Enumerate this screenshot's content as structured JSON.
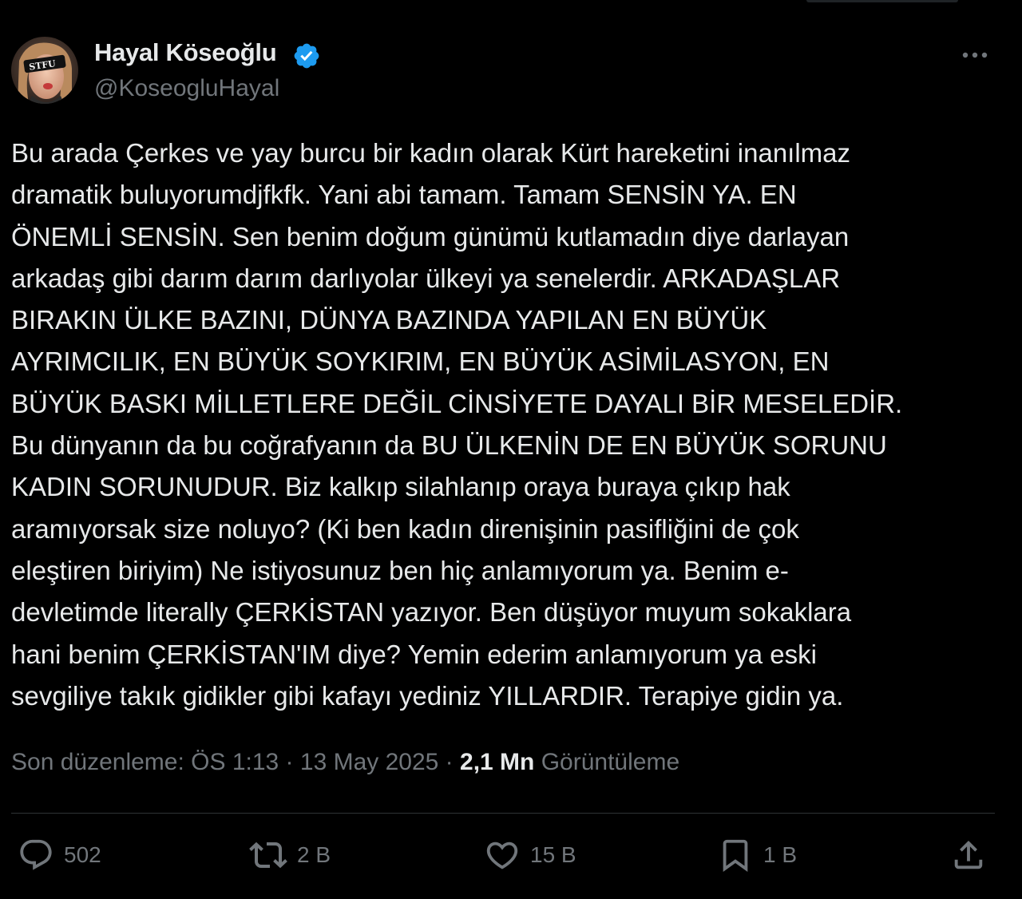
{
  "author": {
    "name": "Hayal Köseoğlu",
    "handle": "@KoseogluHayal",
    "avatar_text": "STFU",
    "verified": true
  },
  "tweet": {
    "lines": [
      "Bu arada Çerkes ve yay burcu bir kadın olarak Kürt hareketini inanılmaz",
      "dramatik buluyorumdjfkfk. Yani abi tamam. Tamam SENSİN YA. EN",
      "ÖNEMLİ SENSİN. Sen benim doğum günümü kutlamadın diye darlayan",
      "arkadaş gibi darım darım darlıyolar ülkeyi ya senelerdir. ARKADAŞLAR",
      "BIRAKIN ÜLKE BAZINI,  DÜNYA BAZINDA YAPILAN EN BÜYÜK",
      "AYRIMCILIK, EN BÜYÜK SOYKIRIM, EN BÜYÜK ASİMİLASYON, EN",
      "BÜYÜK BASKI MİLLETLERE DEĞİL CİNSİYETE DAYALI BİR MESELEDİR.",
      "Bu dünyanın da  bu coğrafyanın da BU ÜLKENİN DE EN BÜYÜK SORUNU",
      "KADIN SORUNUDUR. Biz kalkıp silahlanıp oraya buraya çıkıp hak",
      "aramıyorsak size noluyo? (Ki ben kadın direnişinin pasifliğini de çok",
      "eleştiren biriyim) Ne istiyosunuz ben hiç anlamıyorum ya. Benim e-",
      "devletimde literally ÇERKİSTAN yazıyor. Ben düşüyor muyum sokaklara",
      "hani benim ÇERKİSTAN'IM diye? Yemin ederim anlamıyorum ya eski",
      "sevgiliye takık gidikler gibi kafayı yediniz YILLARDIR. Terapiye gidin ya."
    ]
  },
  "meta": {
    "edited_label": "Son düzenleme: ÖS 1:13",
    "separator": " · ",
    "date": "13 May 2025",
    "views_count": "2,1 Mn",
    "views_label": "Görüntüleme"
  },
  "actions": {
    "reply_count": "502",
    "repost_count": "2 B",
    "like_count": "15 B",
    "bookmark_count": "1 B"
  },
  "colors": {
    "background": "#000000",
    "text": "#e7e9ea",
    "muted": "#71767b",
    "verified": "#1d9bf0",
    "divider": "#2f3336"
  }
}
